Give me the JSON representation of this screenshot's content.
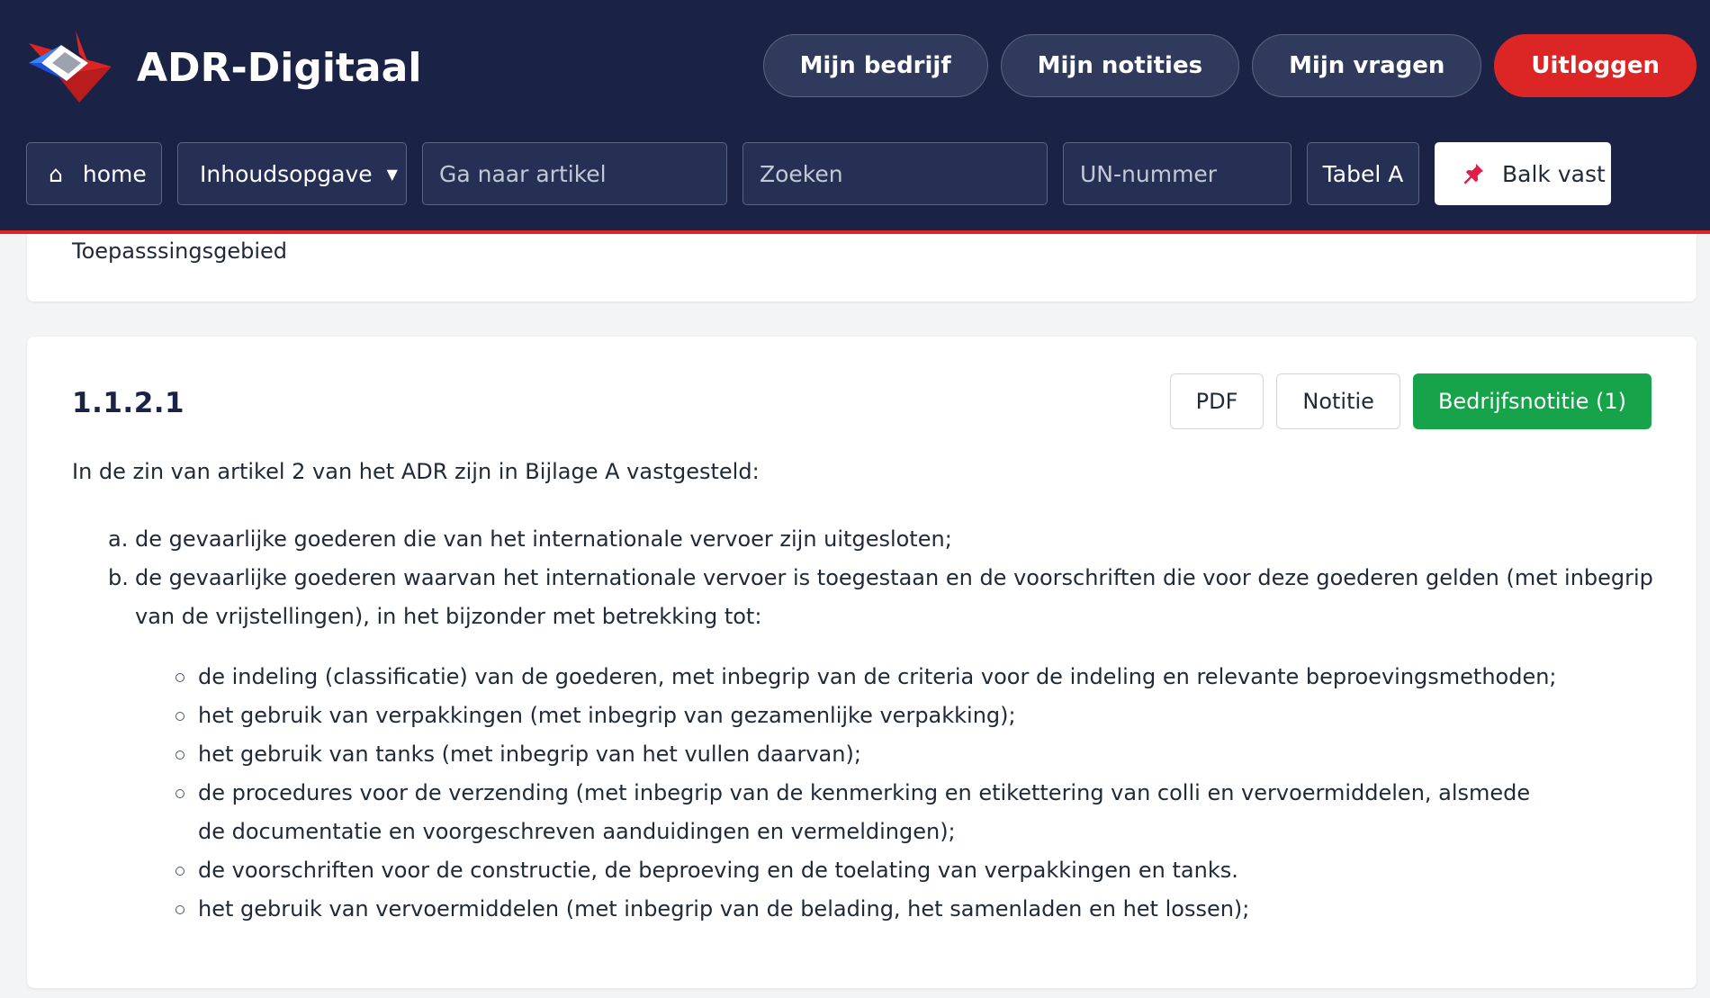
{
  "header": {
    "brand": "ADR-Digitaal",
    "logo_icon": "adr-logo-icon",
    "nav": {
      "company": "Mijn bedrijf",
      "notes": "Mijn notities",
      "questions": "Mijn vragen",
      "logout": "Uitloggen"
    },
    "toolbar": {
      "home_icon": "⌂",
      "home_label": "home",
      "toc_label": "Inhoudsopgave",
      "toc_caret": "▼",
      "article_placeholder": "Ga naar artikel",
      "search_placeholder": "Zoeken",
      "un_placeholder": "UN-nummer",
      "table_label": "Tabel A",
      "pin_label": "Balk vast"
    }
  },
  "colors": {
    "header_bg": "#1a2345",
    "accent_red": "#dc2626",
    "green": "#16a34a"
  },
  "previous_section": {
    "title": "Toepasssingsgebied"
  },
  "article": {
    "number": "1.1.2.1",
    "actions": {
      "pdf": "PDF",
      "note": "Notitie",
      "company_note": "Bedrijfsnotitie (1)"
    },
    "intro": "In de zin van artikel 2 van het ADR zijn in Bijlage A vastgesteld:",
    "items": [
      {
        "marker": "a.",
        "text": "de gevaarlijke goederen die van het internationale vervoer zijn uitgesloten;"
      },
      {
        "marker": "b.",
        "text": "de gevaarlijke goederen waarvan het internationale vervoer is toegestaan en de voorschriften die voor deze goederen gelden (met inbegrip van de vrijstellingen), in het bijzonder met betrekking tot:"
      }
    ],
    "sub_items": [
      "de indeling (classificatie) van de goederen, met inbegrip van de criteria voor de indeling en relevante beproevingsmethoden;",
      "het gebruik van verpakkingen (met inbegrip van gezamenlijke verpakking);",
      "het gebruik van tanks (met inbegrip van het vullen daarvan);",
      "de procedures voor de verzending (met inbegrip van de kenmerking en etikettering van colli en vervoermiddelen, alsmede de documentatie en voorgeschreven aanduidingen en vermeldingen);",
      "de voorschriften voor de constructie, de beproeving en de toelating van verpakkingen en tanks.",
      "het gebruik van vervoermiddelen (met inbegrip van de belading, het samenladen en het lossen);"
    ]
  }
}
